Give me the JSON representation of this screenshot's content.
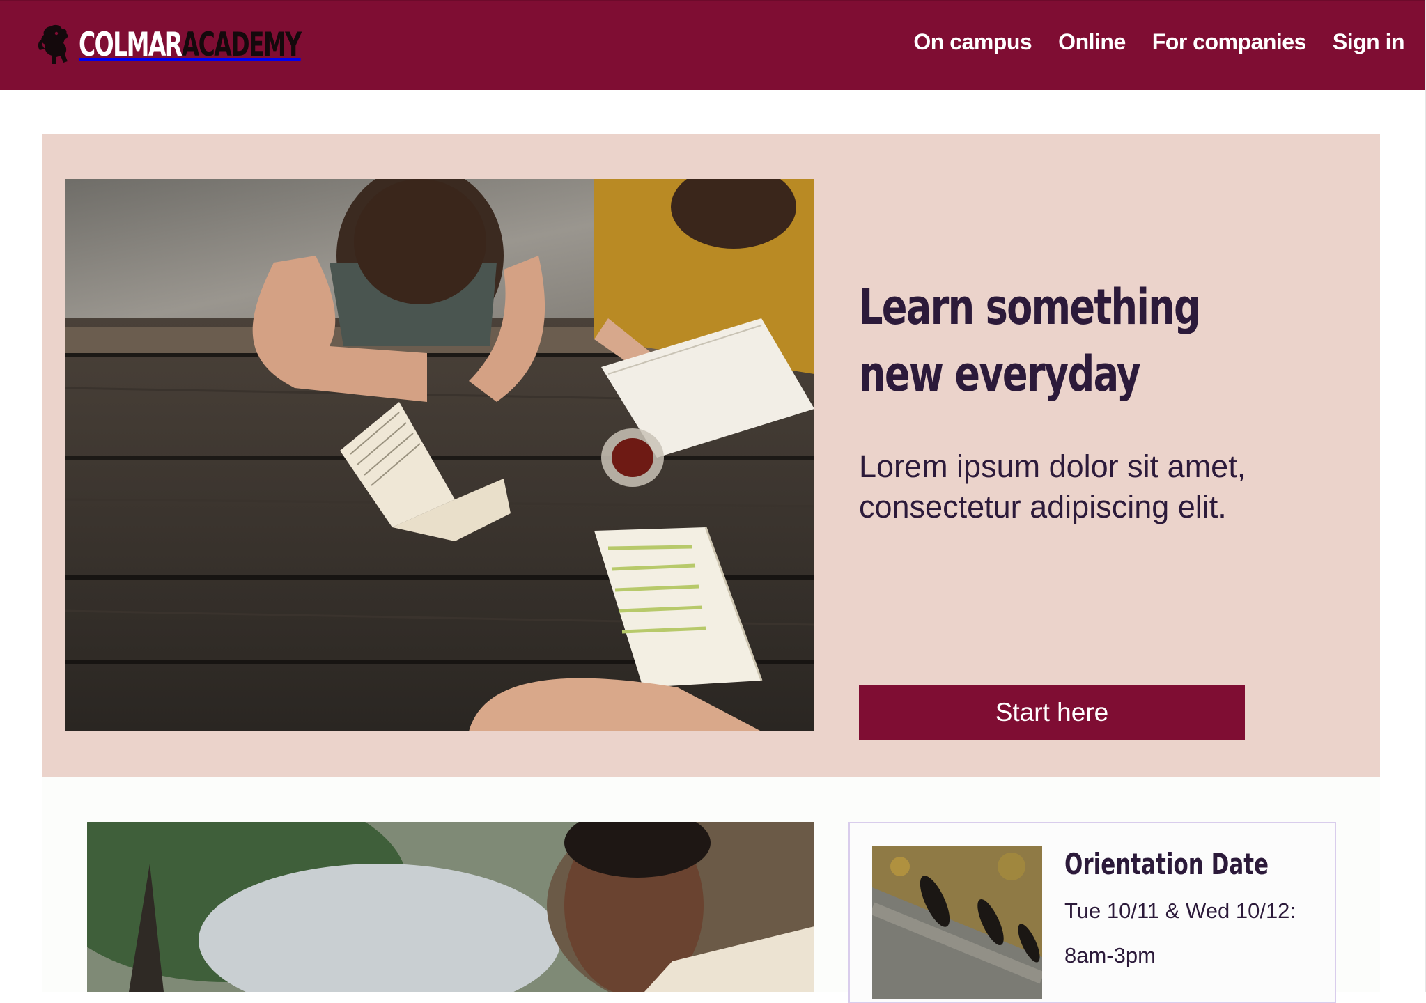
{
  "colors": {
    "brand": "#7f0d33",
    "hero_bg": "#ebd3cb",
    "heading": "#2c1a3a"
  },
  "header": {
    "logo": {
      "part1": "COLMAR",
      "part2": "ACADEMY",
      "icon": "lion-crest-icon"
    },
    "nav": [
      {
        "label": "On campus"
      },
      {
        "label": "Online"
      },
      {
        "label": "For companies"
      },
      {
        "label": "Sign in"
      }
    ]
  },
  "hero": {
    "title": "Learn something new everyday",
    "subtitle": "Lorem ipsum dolor sit amet, consectetur adipiscing elit.",
    "cta_label": "Start here"
  },
  "event": {
    "title": "Orientation Date",
    "lines": [
      "Tue 10/11 & Wed 10/12:",
      "8am-3pm"
    ]
  }
}
